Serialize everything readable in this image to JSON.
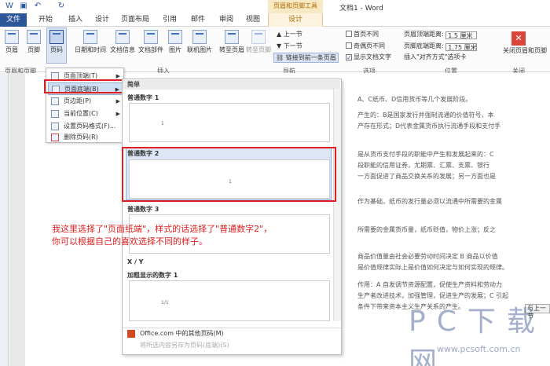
{
  "window": {
    "title": "文档1 - Word",
    "context_group": "页眉和页脚工具"
  },
  "tabs": [
    "文件",
    "开始",
    "插入",
    "设计",
    "页面布局",
    "引用",
    "邮件",
    "审阅",
    "视图",
    "设计"
  ],
  "ribbon": {
    "hf_buttons": [
      "页眉",
      "页脚",
      "页码"
    ],
    "insert_buttons": [
      "日期和时间",
      "文档信息",
      "文档部件",
      "图片",
      "联机图片"
    ],
    "nav": {
      "goto_header": "转至页眉",
      "goto_footer": "转至页脚",
      "prev": "上一节",
      "next": "下一节",
      "link_prev": "链接到前一条页眉"
    },
    "options": {
      "diff_first": "首页不同",
      "diff_oddeven": "奇偶页不同",
      "show_text": "显示文档文字"
    },
    "position": {
      "header_label": "页眉顶端距离:",
      "header_value": "1.5 厘米",
      "footer_label": "页脚底端距离:",
      "footer_value": "1.75 厘米",
      "align_tab": "插入\"对齐方式\"选项卡"
    },
    "close": "关闭页眉和页脚",
    "groups": [
      "页眉和页脚",
      "插入",
      "导航",
      "选项",
      "位置",
      "关闭"
    ]
  },
  "menu": {
    "items": [
      "页面顶端(T)",
      "页面底端(B)",
      "页边距(P)",
      "当前位置(C)",
      "设置页码格式(F)...",
      "删除页码(R)"
    ]
  },
  "gallery": {
    "section_simple": "简单",
    "items": [
      {
        "title": "普通数字 1",
        "sample": "1"
      },
      {
        "title": "普通数字 2",
        "sample": "1"
      },
      {
        "title": "普通数字 3",
        "sample": ""
      }
    ],
    "section_xy": "X / Y",
    "bold_title": "加粗显示的数字 1",
    "bold_sample": "1/1",
    "more": "Office.com 中的其他页码(M)",
    "save": "将所选内容另存为页码(底端)(S)"
  },
  "document": {
    "lines": [
      "A、C纸币、D信用货币等几个发展阶段。",
      "产生的：B是国家发行并强制流通的价值符号，本",
      "产存在形式；D代表金属货币执行流通手段和支付手",
      "是从货币支付手段的职能中产生和发展起来的：C",
      "段职能的信用证券，尤期票、汇票、支票、银行",
      "一方面促进了商品交换关系的发展；另一方面也是",
      "作为基础，纸币的发行量必须以流通中所需要的金属",
      "所需要的金属货币量，纸币贬值，物价上涨；反之",
      "商品价值量由社会必要劳动时间决定 B 商品以价值",
      "是价值规律实际上是价值如何决定与如何实现的规律。",
      "作用：A 自发调节资源配置，促使生产资料和劳动力",
      "生产者改进技术，加强管理，促进生产的发展；C 引起",
      "条件下带来资本主义生产关系的产生。"
    ],
    "next_btn": "与上一节"
  },
  "annotation": {
    "line1": "我这里选择了\"页面纸端\"，样式的话选择了\"普通数字2\"，",
    "line2": "你可以根据自己的喜欢选择不同的样子。"
  },
  "watermark": {
    "brand": "PC下载网",
    "url": "www.pcsoft.com.cn"
  }
}
